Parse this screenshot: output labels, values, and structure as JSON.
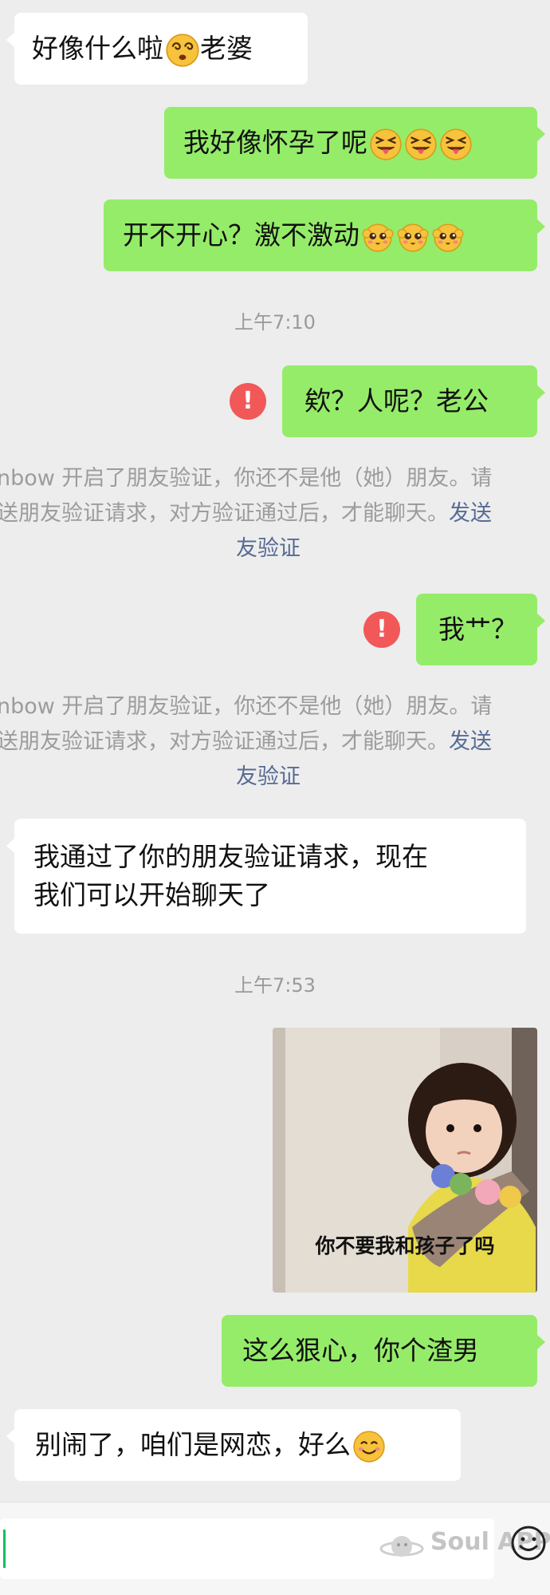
{
  "messages": {
    "m1": "好像什么啦",
    "m1b": "老婆",
    "m2": "我好像怀孕了呢",
    "m3": "开不开心？激不激动",
    "t1": "上午7:10",
    "m4": "欸？人呢？老公",
    "sys1_a": "nbow 开启了朋友验证，你还不是他（她）朋友。请",
    "sys1_b": "送朋友验证请求，对方验证通过后，才能聊天。",
    "sys1_link_a": "发送",
    "sys1_link_b": "友验证",
    "m5": "我艹？",
    "sys2_a": "nbow 开启了朋友验证，你还不是他（她）朋友。请",
    "sys2_b": "送朋友验证请求，对方验证通过后，才能聊天。",
    "sys2_link_a": "发送",
    "sys2_link_b": "友验证",
    "m6_line1": "我通过了你的朋友验证请求，现在",
    "m6_line2": "我们可以开始聊天了",
    "t2": "上午7:53",
    "photo_caption": "你不要我和孩子了吗",
    "m7": "这么狠心，你个渣男",
    "m8": "别闹了，咱们是网恋，好么"
  },
  "error_mark": "!",
  "watermark": "Soul APP",
  "icons": {
    "emoji_dizzy": "dizzy-face-emoji",
    "emoji_tongue": "squinting-tongue-emoji",
    "emoji_excited": "excited-face-emoji",
    "emoji_smile": "smiling-face-emoji",
    "error": "exclamation-circle-icon",
    "emoji_button": "smiley-icon"
  },
  "colors": {
    "background": "#ededed",
    "outgoing_bubble": "#95ec69",
    "incoming_bubble": "#ffffff",
    "error": "#f25858",
    "link": "#576b95"
  }
}
